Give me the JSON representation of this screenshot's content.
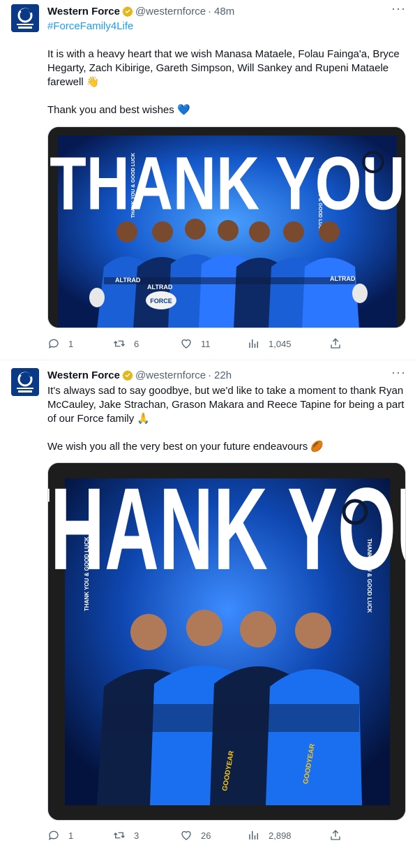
{
  "tweets": [
    {
      "author": "Western Force",
      "handle": "@westernforce",
      "separator": "·",
      "time": "48m",
      "hashtag": "#ForceFamily4Life",
      "text_lines": [
        "It is with a heavy heart that we wish Manasa Mataele, Folau Fainga'a, Bryce Hegarty, Zach Kibirige, Gareth Simpson, Will Sankey and Rupeni Mataele farewell 👋",
        "Thank you and best wishes 💙"
      ],
      "media": {
        "headline": "THANK YOU",
        "side_text": "THANK YOU & GOOD LUCK",
        "kit_text_1": "ALTRAD",
        "kit_text_2": "ALTRAD",
        "ball_text": "FORCE",
        "kit_text_3": "ALTRAD"
      },
      "stats": {
        "replies": "1",
        "retweets": "6",
        "likes": "11",
        "views": "1,045"
      }
    },
    {
      "author": "Western Force",
      "handle": "@westernforce",
      "separator": "·",
      "time": "22h",
      "text_lines": [
        "It's always sad to say goodbye, but we'd like to take a moment to thank Ryan McCauley, Jake Strachan, Grason Makara and Reece Tapine for being a part of our Force family 🙏",
        "We wish you all the very best on your future endeavours 🏉"
      ],
      "media": {
        "headline": "THANK YOU",
        "side_text": "THANK YOU & GOOD LUCK",
        "kit_text_1": "GOODYEAR",
        "kit_text_2": "GOODYEAR"
      },
      "stats": {
        "replies": "1",
        "retweets": "3",
        "likes": "26",
        "views": "2,898"
      }
    }
  ],
  "icons": {
    "verified": "verified-badge-icon",
    "more": "more-icon",
    "reply": "reply-icon",
    "retweet": "retweet-icon",
    "like": "like-icon",
    "views": "views-icon",
    "share": "share-icon"
  },
  "colors": {
    "link": "#1d9bf0",
    "muted": "#536471",
    "text": "#0f1419",
    "badge": "#e2b719",
    "brand": "#0a3a86"
  }
}
